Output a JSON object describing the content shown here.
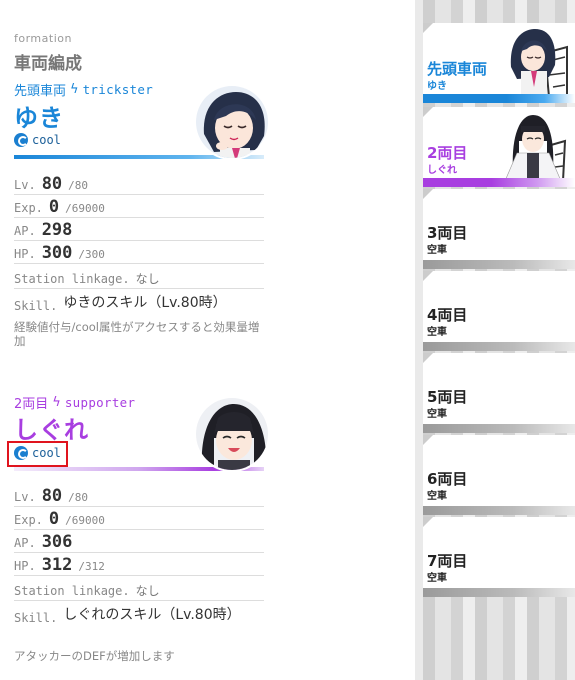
{
  "section": {
    "subtitle": "formation",
    "title": "車両編成"
  },
  "cars": [
    {
      "position_label": "先頭車両",
      "role": "trickster",
      "name": "ゆき",
      "attribute": "cool",
      "accent_color": "#1a86d8",
      "stats": {
        "lv_label": "Lv.",
        "lv": "80",
        "lv_max": "/80",
        "exp_label": "Exp.",
        "exp": "0",
        "exp_max": "/69000",
        "ap_label": "AP.",
        "ap": "298",
        "hp_label": "HP.",
        "hp": "300",
        "hp_max": "/300",
        "linkage_label": "Station linkage.",
        "linkage": "なし"
      },
      "skill_label": "Skill.",
      "skill_name": "ゆきのスキル（Lv.80時）",
      "skill_desc": "経験値付与/cool属性がアクセスすると効果量増加"
    },
    {
      "position_label": "2両目",
      "role": "supporter",
      "name": "しぐれ",
      "attribute": "cool",
      "accent_color": "#a83ee0",
      "stats": {
        "lv_label": "Lv.",
        "lv": "80",
        "lv_max": "/80",
        "exp_label": "Exp.",
        "exp": "0",
        "exp_max": "/69000",
        "ap_label": "AP.",
        "ap": "306",
        "hp_label": "HP.",
        "hp": "312",
        "hp_max": "/312",
        "linkage_label": "Station linkage.",
        "linkage": "なし"
      },
      "skill_label": "Skill.",
      "skill_name": "しぐれのスキル（Lv.80時）",
      "skill_desc": "アタッカーのDEFが増加します"
    }
  ],
  "train": [
    {
      "label": "先頭車両",
      "sub": "ゆき",
      "color": "#1a86d8",
      "occupied": true
    },
    {
      "label": "2両目",
      "sub": "しぐれ",
      "color": "#a83ee0",
      "occupied": true
    },
    {
      "label": "3両目",
      "sub": "空車",
      "color": "#222222",
      "occupied": false
    },
    {
      "label": "4両目",
      "sub": "空車",
      "color": "#222222",
      "occupied": false
    },
    {
      "label": "5両目",
      "sub": "空車",
      "color": "#222222",
      "occupied": false
    },
    {
      "label": "6両目",
      "sub": "空車",
      "color": "#222222",
      "occupied": false
    },
    {
      "label": "7両目",
      "sub": "空車",
      "color": "#222222",
      "occupied": false
    }
  ],
  "icons": {
    "role": "lightning-bolt-icon",
    "attribute": "cool-attribute-icon"
  }
}
